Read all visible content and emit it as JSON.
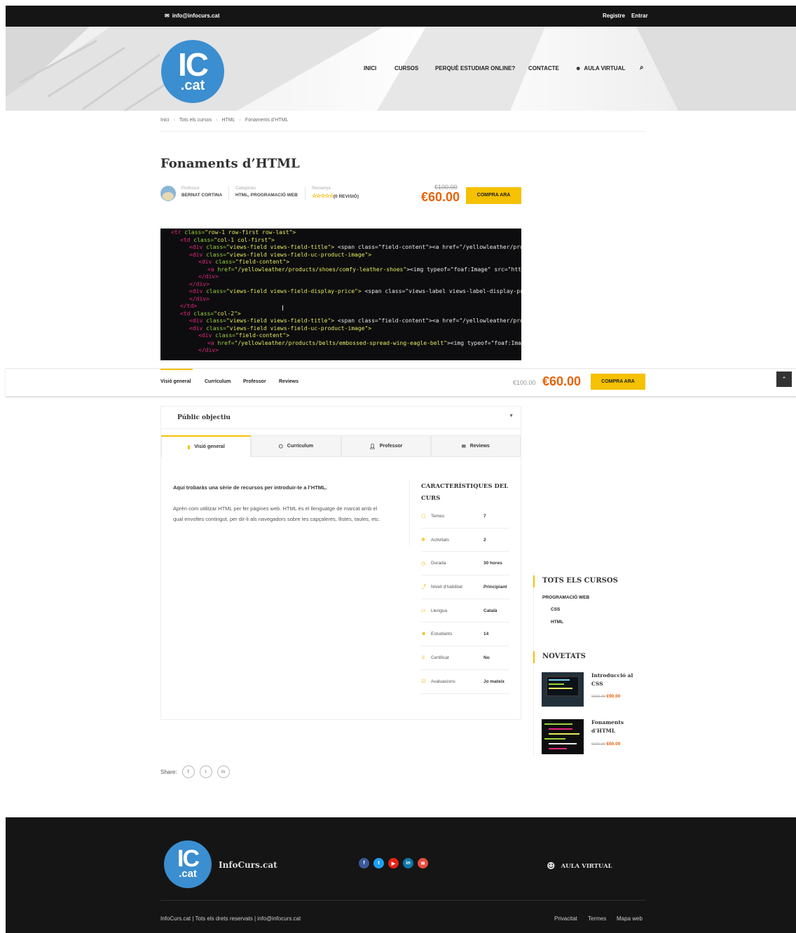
{
  "topbar": {
    "email": "info@infocurs.cat",
    "register": "Registre",
    "login": "Entrar"
  },
  "logo": {
    "ic": "IC",
    "cat": ".cat"
  },
  "nav": {
    "items": [
      "INICI",
      "CURSOS",
      "PERQUÈ ESTUDIAR ONLINE?",
      "CONTACTE",
      "AULA VIRTUAL"
    ]
  },
  "breadcrumb": [
    "Inici",
    "Tots els cursos",
    "HTML",
    "Fonaments d’HTML"
  ],
  "course": {
    "title": "Fonaments d’HTML",
    "teacher_label": "Professor",
    "teacher": "BERNAT CORTINA",
    "categories_label": "Categories",
    "categories": "HTML, PROGRAMACIÓ WEB",
    "review_label": "Ressenya",
    "stars": "☆☆☆☆☆",
    "review_count": "(0 REVISIÓ)",
    "old_price": "€100.00",
    "price": "€60.00",
    "buy": "COMPRA ARA"
  },
  "code_lines": [
    {
      "indent": 1,
      "tag": "<tr",
      "attr": " class=",
      "val": "\"row-1 row-first row-last\">"
    },
    {
      "indent": 2,
      "tag": "<td",
      "attr": " class=",
      "val": "\"col-1 col-first\">"
    },
    {
      "indent": 3,
      "tag": "<div",
      "attr": " class=",
      "val": "\"views-field views-field-title\">",
      "rest": " <span class=\"field-content\"><a href=\"/yellowleather/products"
    },
    {
      "indent": 3,
      "tag": "<div",
      "attr": " class=",
      "val": "\"views-field views-field-uc-product-image\">"
    },
    {
      "indent": 4,
      "tag": "<div",
      "attr": " class=",
      "val": "\"field-content\">"
    },
    {
      "indent": 5,
      "tag": "<a",
      "attr": " href=",
      "val": "\"/yellowleather/products/shoes/comfy-leather-shoes\"",
      "rest": "><img typeof=\"foaf:Image\" src=\"https://yel"
    },
    {
      "indent": 4,
      "tag": "</div>",
      "attr": "",
      "val": ""
    },
    {
      "indent": 3,
      "tag": "</div>",
      "attr": "",
      "val": ""
    },
    {
      "indent": 3,
      "tag": "<div",
      "attr": " class=",
      "val": "\"views-field views-field-display-price\">",
      "rest": " <span class=\"views-label views-label-display-price\">Pr"
    },
    {
      "indent": 3,
      "tag": "</div>",
      "attr": "",
      "val": ""
    },
    {
      "indent": 2,
      "tag": "</td>",
      "attr": "",
      "val": ""
    },
    {
      "indent": 2,
      "tag": "<td",
      "attr": " class=",
      "val": "\"col-2\">"
    },
    {
      "indent": 3,
      "tag": "<div",
      "attr": " class=",
      "val": "\"views-field views-field-title\">",
      "rest": " <span class=\"field-content\"><a href=\"/yellowleather/products"
    },
    {
      "indent": 3,
      "tag": "<div",
      "attr": " class=",
      "val": "\"views-field views-field-uc-product-image\">"
    },
    {
      "indent": 4,
      "tag": "<div",
      "attr": " class=",
      "val": "\"field-content\">"
    },
    {
      "indent": 5,
      "tag": "<a",
      "attr": " href=",
      "val": "\"/yellowleather/products/belts/embossed-spread-wing-eagle-belt\"",
      "rest": "><img typeof=\"foaf:Image\" src"
    },
    {
      "indent": 4,
      "tag": "</div>",
      "attr": "",
      "val": ""
    }
  ],
  "sticky": {
    "tabs": [
      "Visió general",
      "Currículum",
      "Professor",
      "Reviews"
    ],
    "old_price": "€100.00",
    "price": "€60.00",
    "buy": "COMPRA ARA"
  },
  "audience_title": "Públic objectiu",
  "tabs": [
    "Visió general",
    "Currículum",
    "Professor",
    "Reviews"
  ],
  "overview": {
    "intro": "Aquí trobaràs una sèrie de recursos per introduir-te a l’HTML.",
    "body": "Aprèn com utilitzar HTML per fer pàgines web. HTML és el llenguatge de marcat amb el qual envoltes contingut, per dir-li als navegadors sobre les capçaleres, llistes, taules, etc."
  },
  "features": {
    "title": "CARACTERÍSTIQUES DEL CURS",
    "rows": [
      {
        "icon": "file-icon",
        "glyph": "▢",
        "label": "Temes",
        "value": "7"
      },
      {
        "icon": "puzzle-icon",
        "glyph": "✤",
        "label": "Activitats",
        "value": "2"
      },
      {
        "icon": "clock-icon",
        "glyph": "◷",
        "label": "Durada",
        "value": "30 hores"
      },
      {
        "icon": "level-icon",
        "glyph": "⤴",
        "label": "Nivell d'habilitat",
        "value": "Principiant"
      },
      {
        "icon": "language-icon",
        "glyph": "▭",
        "label": "Llengua",
        "value": "Català"
      },
      {
        "icon": "students-icon",
        "glyph": "☻",
        "label": "Estudiants",
        "value": "14"
      },
      {
        "icon": "certificate-icon",
        "glyph": "♕",
        "label": "Certificat",
        "value": "No"
      },
      {
        "icon": "check-icon",
        "glyph": "☑",
        "label": "Avaluacions",
        "value": "Jo mateix"
      }
    ]
  },
  "sidebar": {
    "all_title": "TOTS ELS CURSOS",
    "category": "PROGRAMACIÓ WEB",
    "sub": [
      "CSS",
      "HTML"
    ],
    "new_title": "NOVETATS",
    "new_items": [
      {
        "title_a": "Introducció al",
        "title_b": "CSS",
        "old": "€150.00",
        "price": "€90.00"
      },
      {
        "title_a": "Fonaments",
        "title_b": "d’HTML",
        "old": "€100.00",
        "price": "€60.00"
      }
    ]
  },
  "share": {
    "label": "Share:",
    "icons": [
      "f",
      "t",
      "in"
    ]
  },
  "footer": {
    "brand": "InfoCurs.cat",
    "aula": "AULA VIRTUAL",
    "copyright": "InfoCurs.cat | Tots els drets reservats | info@infocurs.cat",
    "links": [
      "Privacitat",
      "Termes",
      "Mapa web"
    ],
    "social": [
      {
        "icon": "facebook-icon",
        "glyph": "f",
        "color": "#3b5998"
      },
      {
        "icon": "twitter-icon",
        "glyph": "t",
        "color": "#1da1f2"
      },
      {
        "icon": "youtube-icon",
        "glyph": "▶",
        "color": "#e62117"
      },
      {
        "icon": "linkedin-icon",
        "glyph": "in",
        "color": "#0e76a8"
      },
      {
        "icon": "email-icon",
        "glyph": "✉",
        "color": "#e74c3c"
      }
    ]
  },
  "colors": {
    "accent": "#f5c100",
    "price": "#e9620a",
    "brand": "#3b8ed0"
  }
}
